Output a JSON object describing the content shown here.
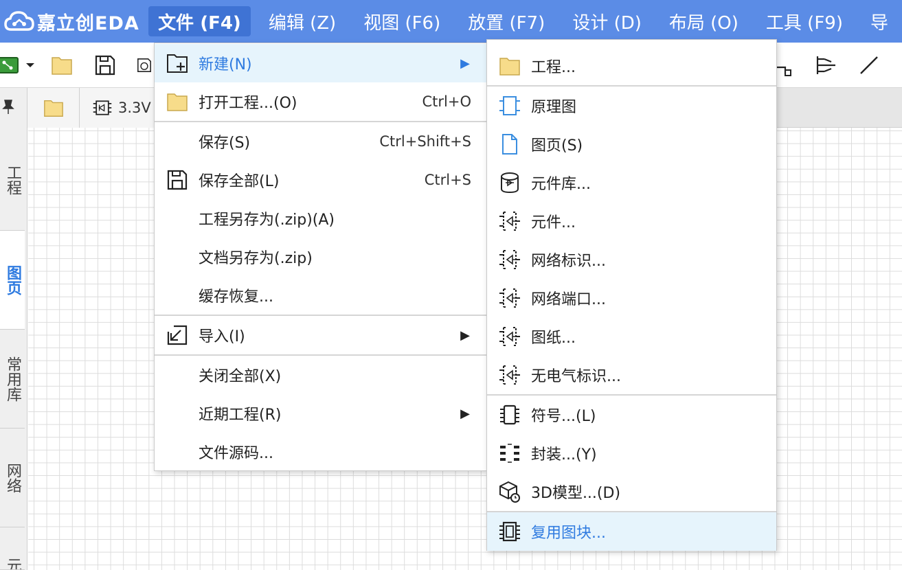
{
  "app": {
    "logo_text": "嘉立创EDA"
  },
  "menubar": {
    "items": [
      {
        "label": "文件 (F4)",
        "active": true
      },
      {
        "label": "编辑 (Z)"
      },
      {
        "label": "视图 (F6)"
      },
      {
        "label": "放置 (F7)"
      },
      {
        "label": "设计 (D)"
      },
      {
        "label": "布局 (O)"
      },
      {
        "label": "工具 (F9)"
      },
      {
        "label": "导"
      }
    ]
  },
  "tabs": {
    "items": [
      {
        "label": ""
      },
      {
        "label": "3.3V"
      }
    ]
  },
  "left_panel": {
    "tabs": [
      {
        "label": "工程"
      },
      {
        "label": "图页",
        "active": true
      },
      {
        "label": "常用库"
      },
      {
        "label": "网络"
      },
      {
        "label": "元"
      }
    ]
  },
  "file_menu": {
    "items": [
      {
        "label": "新建(N)",
        "shortcut": "",
        "icon": "new-folder-icon",
        "submenu": true,
        "highlighted": true
      },
      {
        "label": "打开工程...(O)",
        "shortcut": "Ctrl+O",
        "icon": "folder-icon"
      },
      {
        "label": "保存(S)",
        "shortcut": "Ctrl+Shift+S"
      },
      {
        "label": "保存全部(L)",
        "shortcut": "Ctrl+S",
        "icon": "save-icon"
      },
      {
        "label": "工程另存为(.zip)(A)",
        "shortcut": ""
      },
      {
        "label": "文档另存为(.zip)",
        "shortcut": ""
      },
      {
        "label": "缓存恢复...",
        "shortcut": ""
      },
      {
        "label": "导入(I)",
        "shortcut": "",
        "icon": "import-icon",
        "submenu": true
      },
      {
        "label": "关闭全部(X)",
        "shortcut": ""
      },
      {
        "label": "近期工程(R)",
        "shortcut": "",
        "submenu": true
      },
      {
        "label": "文件源码...",
        "shortcut": ""
      }
    ]
  },
  "new_submenu": {
    "items": [
      {
        "label": "工程...",
        "icon": "folder-icon"
      },
      {
        "label": "原理图",
        "icon": "schematic-icon"
      },
      {
        "label": "图页(S)",
        "icon": "page-icon"
      },
      {
        "label": "元件库...",
        "icon": "library-icon"
      },
      {
        "label": "元件...",
        "icon": "component-icon"
      },
      {
        "label": "网络标识...",
        "icon": "component-icon"
      },
      {
        "label": "网络端口...",
        "icon": "component-icon"
      },
      {
        "label": "图纸...",
        "icon": "component-icon"
      },
      {
        "label": "无电气标识...",
        "icon": "component-icon"
      },
      {
        "label": "符号...(L)",
        "icon": "symbol-icon"
      },
      {
        "label": "封装...(Y)",
        "icon": "footprint-icon"
      },
      {
        "label": "3D模型...(D)",
        "icon": "3d-model-icon"
      },
      {
        "label": "复用图块...",
        "icon": "reuse-block-icon",
        "highlighted": true
      }
    ]
  },
  "colors": {
    "menubar_bg": "#5b8ce6",
    "menubar_active": "#3f73d4",
    "highlight_bg": "#e6f4fc",
    "accent_text": "#2f7be0",
    "folder_fill": "#f7dc8a"
  }
}
